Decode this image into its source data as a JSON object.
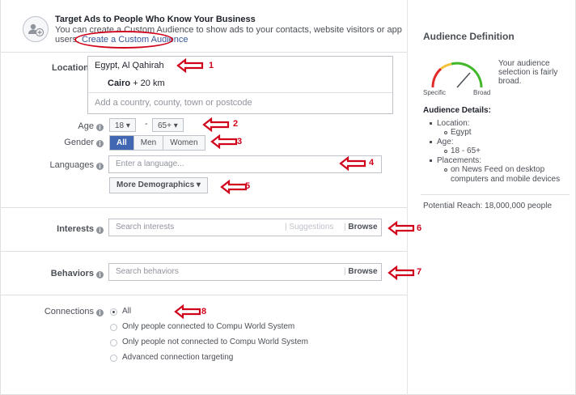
{
  "custom_audience": {
    "title": "Target Ads to People Who Know Your Business",
    "desc_line1": "You can create a Custom Audience to show ads to your contacts, website visitors or app",
    "desc_line2": "users.",
    "link": "Create a Custom Audience"
  },
  "locations": {
    "label": "Locations",
    "country": "Egypt, Al Qahirah",
    "city": "Cairo",
    "radius": "+ 20 km",
    "placeholder": "Add a country, county, town or postcode"
  },
  "age": {
    "label": "Age",
    "min": "18",
    "max": "65+",
    "dash": "-"
  },
  "gender": {
    "label": "Gender",
    "options": [
      "All",
      "Men",
      "Women"
    ],
    "selected": "All"
  },
  "languages": {
    "label": "Languages",
    "placeholder": "Enter a language..."
  },
  "more_demographics": {
    "label": "More Demographics"
  },
  "interests": {
    "label": "Interests",
    "placeholder": "Search interests",
    "suggestions": "Suggestions",
    "browse": "Browse"
  },
  "behaviors": {
    "label": "Behaviors",
    "placeholder": "Search behaviors",
    "browse": "Browse"
  },
  "connections": {
    "label": "Connections",
    "options": [
      "All",
      "Only people connected to Compu World System",
      "Only people not connected to Compu World System",
      "Advanced connection targeting"
    ],
    "selected": "All"
  },
  "annotations": {
    "numbers": [
      "1",
      "2",
      "3",
      "4",
      "5",
      "6",
      "7",
      "8"
    ],
    "color": "#d0021b"
  },
  "audience_definition": {
    "title": "Audience Definition",
    "gauge_specific": "Specific",
    "gauge_broad": "Broad",
    "gauge_text": "Your audience selection is fairly broad.",
    "details_title": "Audience Details:",
    "location_label": "Location:",
    "location_value": "Egypt",
    "age_label": "Age:",
    "age_value": "18 - 65+",
    "placements_label": "Placements:",
    "placements_value_1": "on News Feed on desktop",
    "placements_value_2": "computers and mobile devices",
    "potential_reach": "Potential Reach: 18,000,000 people"
  },
  "colors": {
    "primary": "#4267b2",
    "link": "#365899",
    "annotation": "#d0021b",
    "gauge_red": "#e02b27",
    "gauge_yellow": "#f5c33b",
    "gauge_green": "#42b72a"
  }
}
